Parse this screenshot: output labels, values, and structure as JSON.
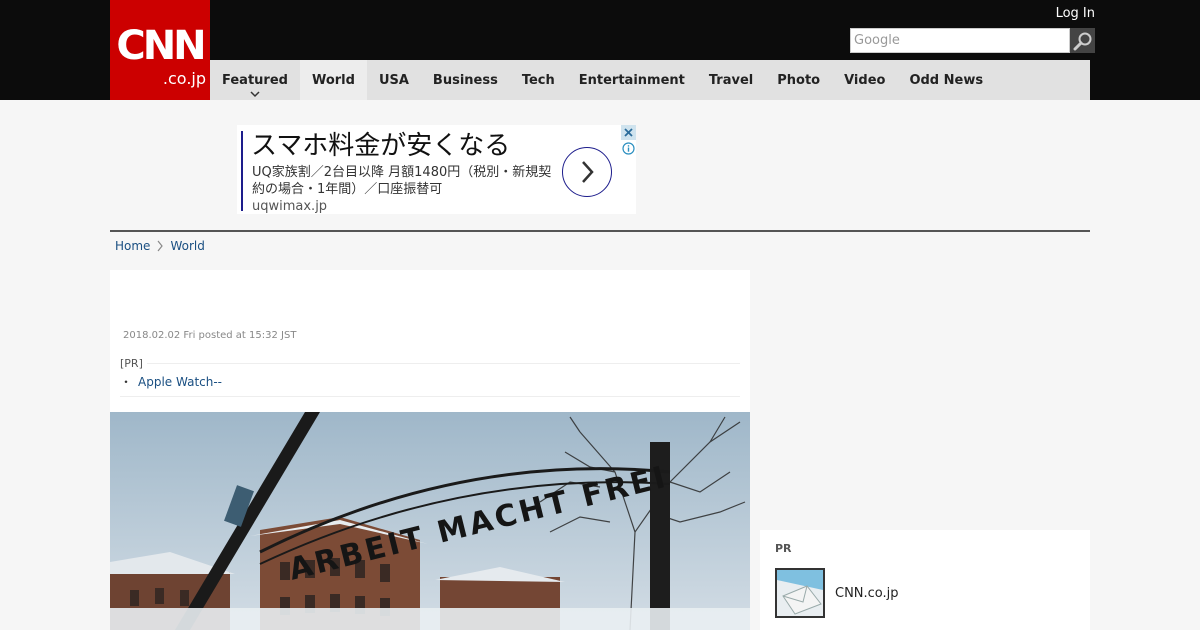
{
  "header": {
    "logo_main": "CNN",
    "logo_sub": ".co.jp",
    "login_label": "Log In",
    "search_placeholder": "Google"
  },
  "nav": {
    "items": [
      {
        "label": "Featured"
      },
      {
        "label": "World"
      },
      {
        "label": "USA"
      },
      {
        "label": "Business"
      },
      {
        "label": "Tech"
      },
      {
        "label": "Entertainment"
      },
      {
        "label": "Travel"
      },
      {
        "label": "Photo"
      },
      {
        "label": "Video"
      },
      {
        "label": "Odd News"
      }
    ],
    "active": "World"
  },
  "ad": {
    "headline": "スマホ料金が安くなる",
    "description": "UQ家族割／2台目以降 月額1480円（税別・新規契約の場合・1年間）／口座振替可",
    "domain": "uqwimax.jp"
  },
  "breadcrumb": {
    "home": "Home",
    "section": "World"
  },
  "article": {
    "date": "2018.02.02 Fri posted at 15:32 JST",
    "pr_label": "[PR]",
    "pr_bullet": "・",
    "pr_link": "Apple Watch--"
  },
  "sidebar_pr": {
    "label": "PR",
    "name": "CNN.co.jp"
  },
  "colors": {
    "brand_red": "#cc0000",
    "topbar": "#0c0c0c",
    "nav_bg": "#e1e1e1",
    "link": "#1a4f82"
  }
}
